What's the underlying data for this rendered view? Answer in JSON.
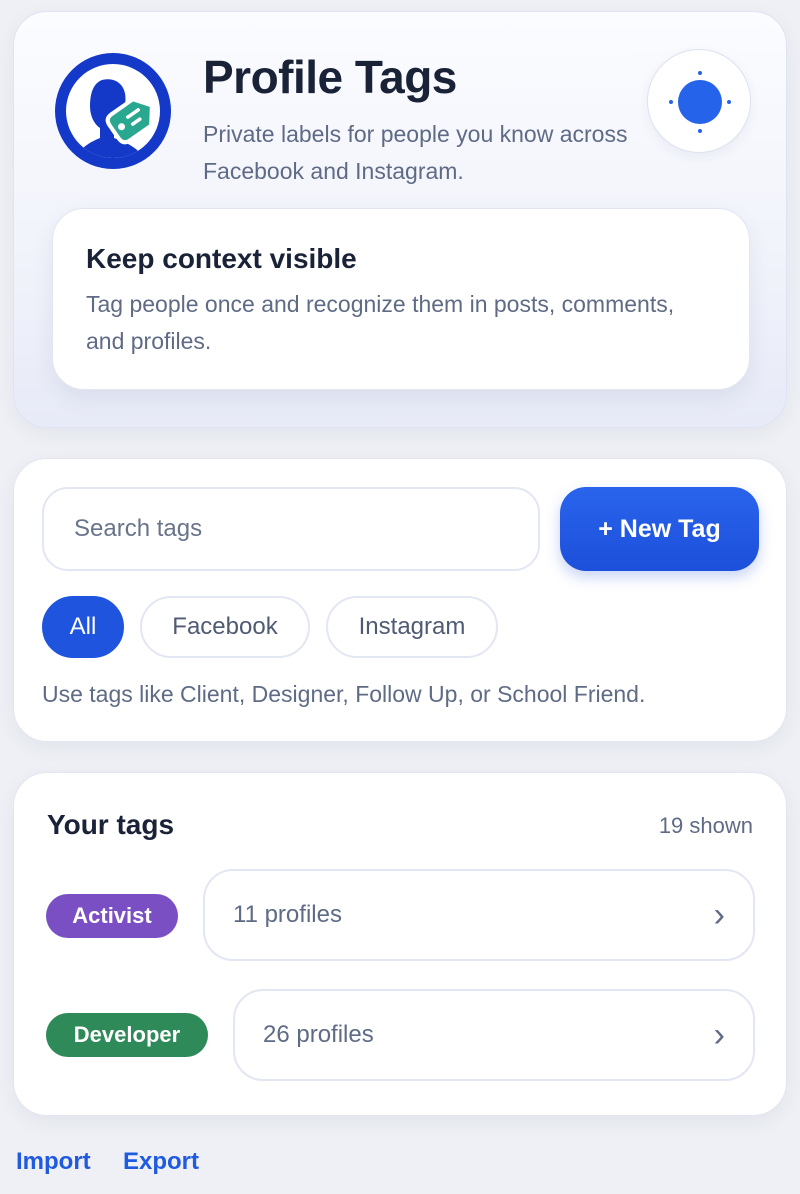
{
  "header": {
    "title": "Profile Tags",
    "subtitle": "Private labels for people you know across Facebook and Instagram.",
    "logo_icon": "person-tag-icon",
    "theme_icon": "sun-icon",
    "info": {
      "title": "Keep context visible",
      "text": "Tag people once and recognize them in posts, comments, and profiles."
    }
  },
  "controls": {
    "search_placeholder": "Search tags",
    "new_tag_label": "+ New Tag",
    "filters": [
      "All",
      "Facebook",
      "Instagram"
    ],
    "active_filter": "All",
    "hint": "Use tags like Client, Designer, Follow Up, or School Friend."
  },
  "tags": {
    "title": "Your tags",
    "count_label": "19 shown",
    "items": [
      {
        "name": "Activist",
        "profiles": "11 profiles",
        "color": "#7a4fc4"
      },
      {
        "name": "Developer",
        "profiles": "26 profiles",
        "color": "#2e8a58"
      }
    ]
  },
  "footer": {
    "import_label": "Import",
    "export_label": "Export"
  },
  "colors": {
    "accent": "#1f55de",
    "text": "#1a2238",
    "muted": "#5f6b85"
  }
}
